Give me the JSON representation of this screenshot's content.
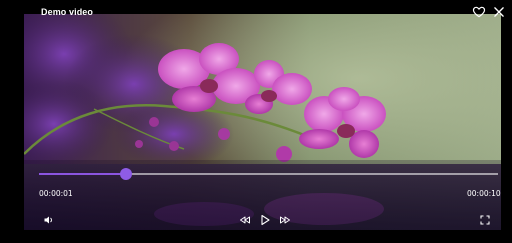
{
  "player": {
    "title": "Demo video",
    "current_time": "00:00:01",
    "duration": "00:00:10",
    "progress": 0.19
  },
  "icons": {
    "favorite": "heart-icon",
    "close": "close-icon",
    "volume": "volume-icon",
    "rewind": "rewind-icon",
    "play": "play-icon",
    "forward": "fast-forward-icon",
    "fullscreen": "fullscreen-icon"
  },
  "colors": {
    "accent": "#8b55e0",
    "background": "#000000"
  }
}
